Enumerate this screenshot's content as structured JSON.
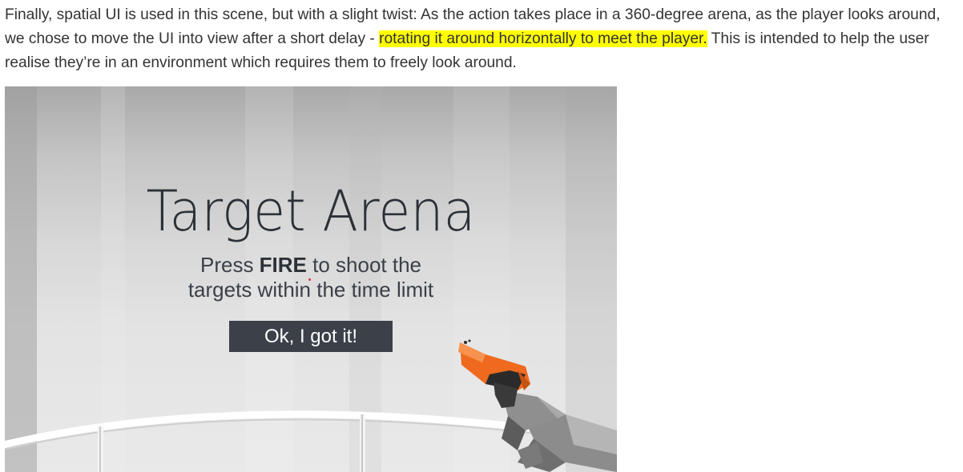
{
  "article": {
    "paragraph_before": "Finally, spatial UI is used in this scene, but with a slight twist: As the action takes place in a 360-degree arena, as the player looks around, we chose to move the UI into view after a short delay - ",
    "highlight": "rotating it around horizontally to meet the player.",
    "paragraph_after": " This is intended to help the user realise they’re in an environment which requires them to freely look around."
  },
  "game": {
    "title": "Target Arena",
    "instruction_prefix": "Press ",
    "instruction_bold": "FIRE",
    "instruction_line1_rest": " to shoot the",
    "instruction_line2": "targets within the time limit",
    "button_label": "Ok, I got it!"
  },
  "colors": {
    "highlight": "#ffff00",
    "gun_orange": "#ef6a1f",
    "button_bg": "#3b4049"
  }
}
